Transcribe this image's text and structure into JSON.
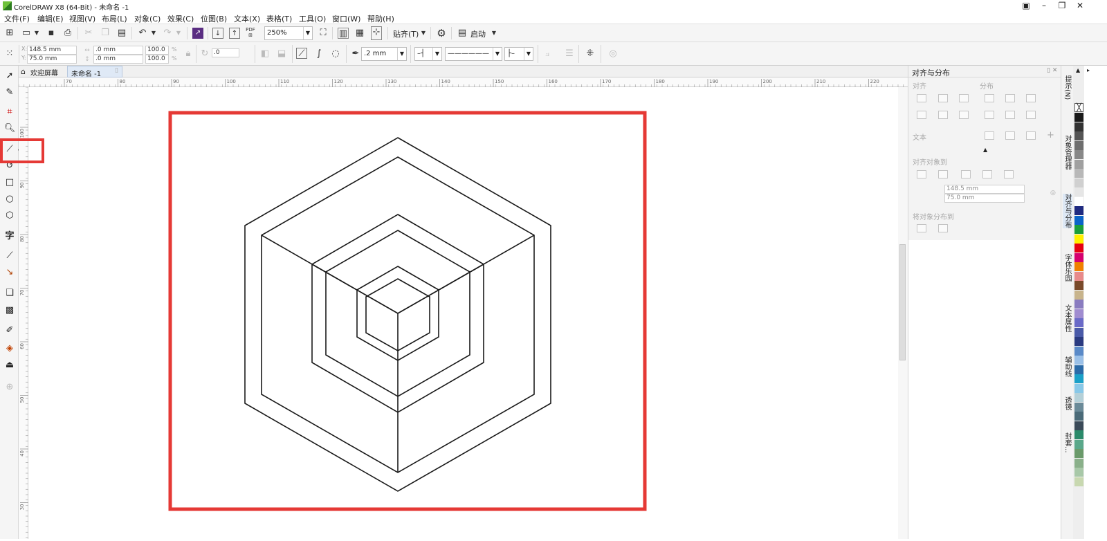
{
  "window": {
    "title": "CorelDRAW X8 (64-Bit) - 未命名 -1"
  },
  "menu": [
    "文件(F)",
    "编辑(E)",
    "视图(V)",
    "布局(L)",
    "对象(C)",
    "效果(C)",
    "位图(B)",
    "文本(X)",
    "表格(T)",
    "工具(O)",
    "窗口(W)",
    "帮助(H)"
  ],
  "toolbar": {
    "zoom": "250%",
    "snap_label": "贴齐(T)",
    "launch_label": "启动"
  },
  "property_bar": {
    "x": "148.5 mm",
    "y": "75.0 mm",
    "width": ".0 mm",
    "height": ".0 mm",
    "scale_x": "100.0",
    "scale_y": "100.0",
    "angle": ".0",
    "outline_width": ".2 mm",
    "pct": "%"
  },
  "tabs": {
    "welcome": "欢迎屏幕",
    "document": "未命名 -1"
  },
  "ruler_h_labels": [
    "70",
    "80",
    "90",
    "100",
    "110",
    "120",
    "130",
    "140",
    "150",
    "160",
    "170",
    "180",
    "190",
    "200",
    "210",
    "220"
  ],
  "ruler_v_labels": [
    "100",
    "90",
    "80",
    "70",
    "60",
    "50",
    "40",
    "30"
  ],
  "docker": {
    "title": "对齐与分布",
    "section_align": "对齐",
    "section_distribute": "分布",
    "section_text": "文本",
    "section_align_objects": "对齐对象到",
    "x": "148.5 mm",
    "y": "75.0 mm",
    "section_distribute_to": "将对象分布到"
  },
  "side_tabs": [
    "提示(N)",
    "对象管理器",
    "对齐与分布",
    "字体乐园",
    "文本属性",
    "辅助线",
    "透镜",
    "封套..."
  ],
  "palette": [
    "#1a1a1a",
    "#333333",
    "#555555",
    "#6e6e6e",
    "#888888",
    "#a0a0a0",
    "#b8b8b8",
    "#d0d0d0",
    "#e6e6e6",
    "#ffffff",
    "#1f2a80",
    "#0a64c8",
    "#1a9e3a",
    "#fff000",
    "#e60012",
    "#d6006e",
    "#f08000",
    "#e88a8a",
    "#7a4a2a",
    "#c8b48c",
    "#8a7cc0",
    "#a08cd0",
    "#6a6ac8",
    "#4a5aa8",
    "#2a3a80",
    "#5a8ac8",
    "#9ac0e8",
    "#2a6aa8",
    "#1aa0c8",
    "#88c8e8",
    "#b4d0d8",
    "#6a8a98",
    "#4a6a78",
    "#3a4a58",
    "#2a8a6a",
    "#5aa88a",
    "#6a9a6a",
    "#8ab08a",
    "#a8c8a8",
    "#c8d8b0"
  ],
  "accent_color": "#e53935",
  "icons": [
    "pick-tool-icon",
    "shape-tool-icon",
    "crop-tool-icon",
    "zoom-tool-icon",
    "freehand-tool-icon",
    "rectangle-tool-icon",
    "ellipse-tool-icon",
    "polygon-tool-icon",
    "text-tool-icon",
    "parallel-dimension-icon",
    "connector-tool-icon",
    "drop-shadow-icon",
    "transparency-icon",
    "eyedropper-icon",
    "interactive-fill-icon",
    "smart-fill-icon"
  ]
}
